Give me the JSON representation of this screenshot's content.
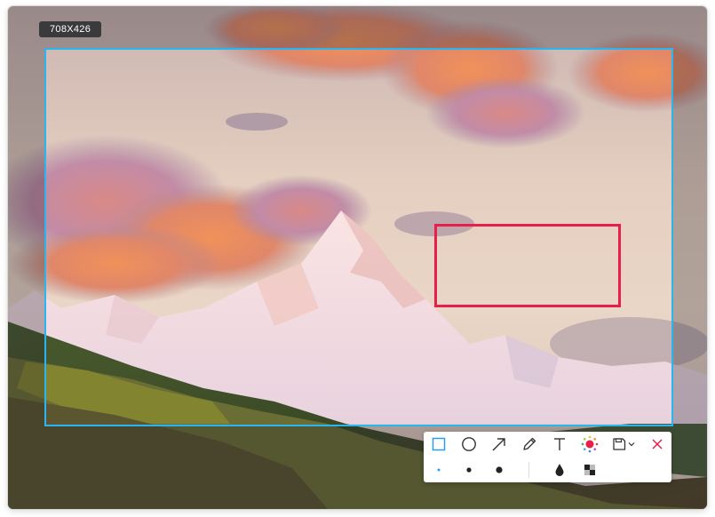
{
  "screenshot_tool": {
    "selection_size_label": "708X426",
    "selection_color": "#2bb5f0",
    "annotation_color": "#e81f4a"
  },
  "toolbar": {
    "row1": [
      {
        "name": "rectangle-tool",
        "icon": "square-icon",
        "active": true
      },
      {
        "name": "ellipse-tool",
        "icon": "circle-icon"
      },
      {
        "name": "arrow-tool",
        "icon": "arrow-icon"
      },
      {
        "name": "pen-tool",
        "icon": "pencil-icon"
      },
      {
        "name": "text-tool",
        "icon": "text-t-icon"
      },
      {
        "name": "color-picker",
        "icon": "color-wheel-icon",
        "current_color": "#e81f4a"
      },
      {
        "name": "save-tool",
        "icon": "save-icon",
        "has_dropdown": true
      },
      {
        "name": "close-tool",
        "icon": "close-icon"
      }
    ],
    "row2": [
      {
        "name": "stroke-small",
        "icon": "dot-small-icon",
        "selected": true
      },
      {
        "name": "stroke-medium",
        "icon": "dot-medium-icon"
      },
      {
        "name": "stroke-large",
        "icon": "dot-large-icon"
      },
      {
        "name": "blur-tool",
        "icon": "droplet-icon"
      },
      {
        "name": "mosaic-tool",
        "icon": "mosaic-icon"
      }
    ]
  }
}
